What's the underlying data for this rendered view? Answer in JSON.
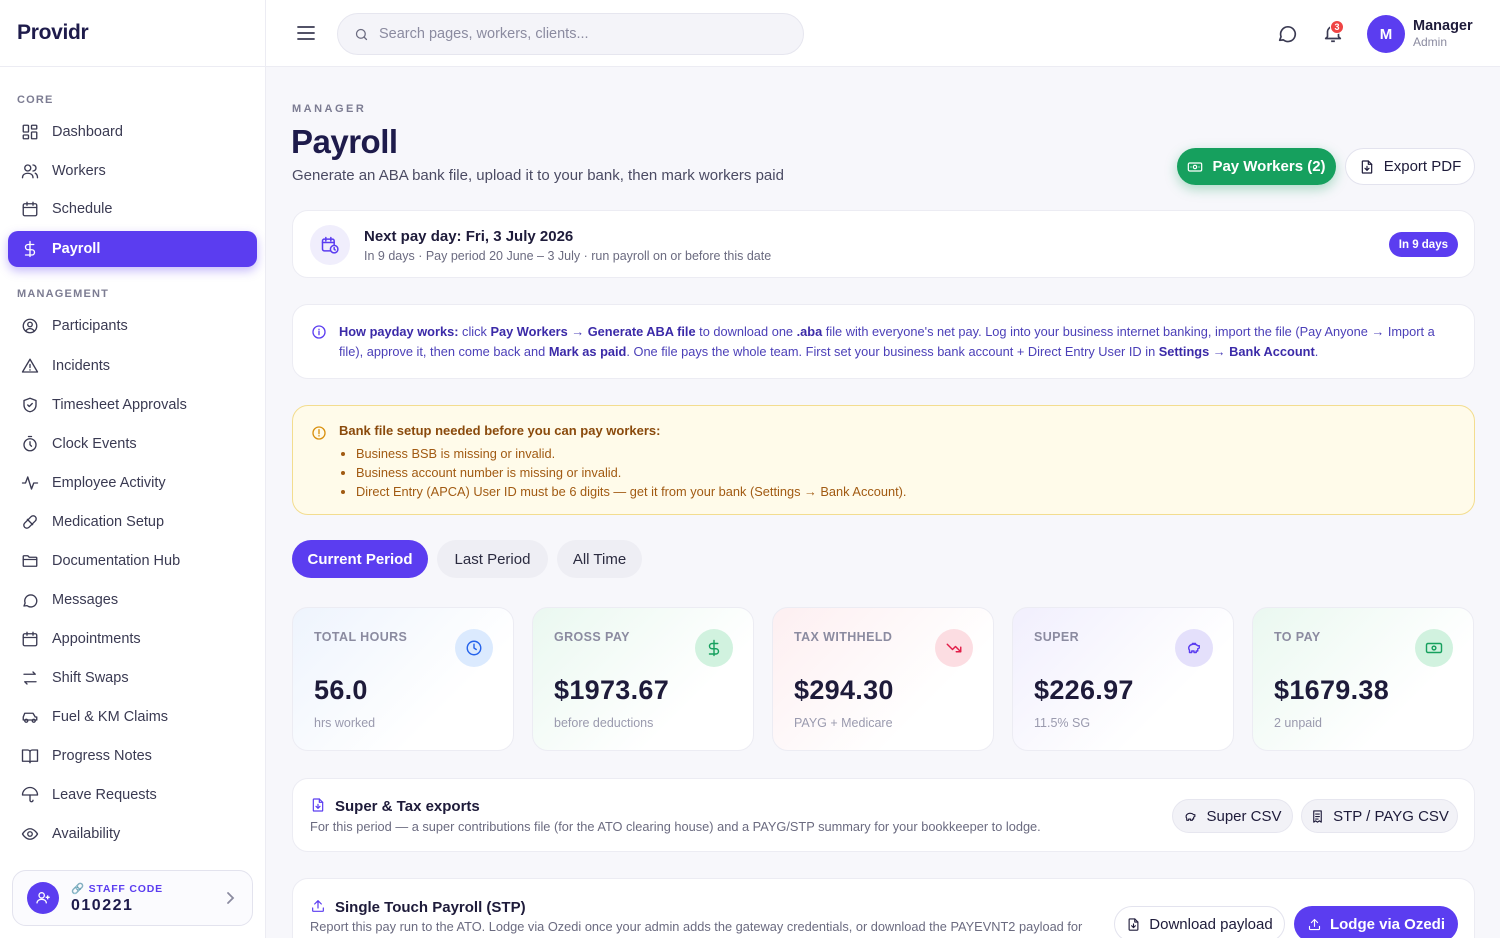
{
  "brand": "Providr",
  "sidebar": {
    "sections": [
      "CORE",
      "MANAGEMENT"
    ],
    "items": [
      {
        "label": "Dashboard",
        "icon": "dashboard-icon"
      },
      {
        "label": "Workers",
        "icon": "users-icon"
      },
      {
        "label": "Schedule",
        "icon": "calendar-icon"
      },
      {
        "label": "Payroll",
        "icon": "dollar-icon",
        "active": true
      },
      {
        "label": "Participants",
        "icon": "user-circle-icon"
      },
      {
        "label": "Incidents",
        "icon": "warning-icon"
      },
      {
        "label": "Timesheet Approvals",
        "icon": "shield-icon"
      },
      {
        "label": "Clock Events",
        "icon": "stopwatch-icon"
      },
      {
        "label": "Employee Activity",
        "icon": "activity-icon"
      },
      {
        "label": "Medication Setup",
        "icon": "pill-icon"
      },
      {
        "label": "Documentation Hub",
        "icon": "folder-icon"
      },
      {
        "label": "Messages",
        "icon": "chat-icon"
      },
      {
        "label": "Appointments",
        "icon": "calendar-icon"
      },
      {
        "label": "Shift Swaps",
        "icon": "swap-icon"
      },
      {
        "label": "Fuel & KM Claims",
        "icon": "car-icon"
      },
      {
        "label": "Progress Notes",
        "icon": "book-icon"
      },
      {
        "label": "Leave Requests",
        "icon": "umbrella-icon"
      },
      {
        "label": "Availability",
        "icon": "eye-icon"
      }
    ],
    "staff_code_label": "STAFF CODE",
    "staff_code": "010221"
  },
  "topbar": {
    "search_placeholder": "Search pages, workers, clients...",
    "notification_count": "3",
    "avatar_initial": "M",
    "user_name": "Manager",
    "user_role": "Admin"
  },
  "header": {
    "eyebrow": "MANAGER",
    "title": "Payroll",
    "subtitle": "Generate an ABA bank file, upload it to your bank, then mark workers paid",
    "pay_button": "Pay Workers (2)",
    "export_button": "Export PDF"
  },
  "payday": {
    "title": "Next pay day: Fri, 3 July 2026",
    "subtitle": "In 9 days · Pay period 20 June – 3 July · run payroll on or before this date",
    "pill": "In 9 days"
  },
  "info": {
    "lead": "How payday works:",
    "t1": " click ",
    "b1": "Pay Workers",
    "t2": " → ",
    "b2": "Generate ABA file",
    "t3": " to download one ",
    "b3": ".aba",
    "t4": " file with everyone's net pay. Log into your business internet banking, import the file (Pay Anyone → Import a file), approve it, then come back and ",
    "b4": "Mark as paid",
    "t5": ". One file pays the whole team. First set your business bank account + Direct Entry User ID in ",
    "b5": "Settings",
    "t6": " → ",
    "b6": "Bank Account",
    "t7": "."
  },
  "warning": {
    "title": "Bank file setup needed before you can pay workers:",
    "items": [
      "Business BSB is missing or invalid.",
      "Business account number is missing or invalid.",
      "Direct Entry (APCA) User ID must be 6 digits — get it from your bank (Settings → Bank Account)."
    ]
  },
  "tabs": [
    "Current Period",
    "Last Period",
    "All Time"
  ],
  "stats": [
    {
      "label": "TOTAL HOURS",
      "value": "56.0",
      "sub": "hrs worked",
      "icon": "clock-icon"
    },
    {
      "label": "GROSS PAY",
      "value": "$1973.67",
      "sub": "before deductions",
      "icon": "dollar-icon"
    },
    {
      "label": "TAX WITHHELD",
      "value": "$294.30",
      "sub": "PAYG + Medicare",
      "icon": "trend-down-icon"
    },
    {
      "label": "SUPER",
      "value": "$226.97",
      "sub": "11.5% SG",
      "icon": "piggy-bank-icon"
    },
    {
      "label": "TO PAY",
      "value": "$1679.38",
      "sub": "2 unpaid",
      "icon": "cash-icon"
    }
  ],
  "exports": {
    "title": "Super & Tax exports",
    "subtitle": "For this period — a super contributions file (for the ATO clearing house) and a PAYG/STP summary for your bookkeeper to lodge.",
    "super_csv": "Super CSV",
    "stp_csv": "STP / PAYG CSV"
  },
  "stp": {
    "title": "Single Touch Payroll (STP)",
    "subtitle": "Report this pay run to the ATO. Lodge via Ozedi once your admin adds the gateway credentials, or download the PAYEVNT2 payload for",
    "download": "Download payload",
    "lodge": "Lodge via Ozedi"
  },
  "colors": {
    "accent": "#5b3df0",
    "success": "#16a05e",
    "warning_bg": "#fffbea",
    "danger": "#ef4444"
  }
}
